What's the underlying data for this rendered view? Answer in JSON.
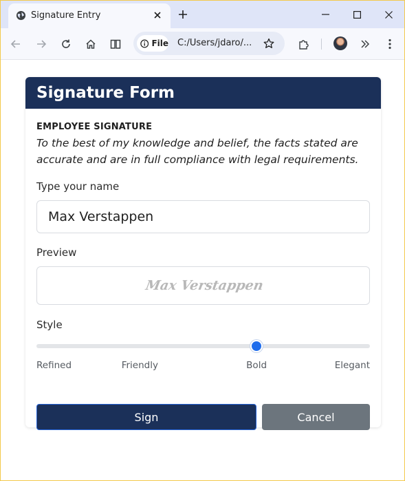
{
  "browser": {
    "tab_title": "Signature Entry",
    "file_chip": "File",
    "url": "C:/Users/jdaro/..."
  },
  "form": {
    "title": "Signature Form",
    "section_heading": "EMPLOYEE SIGNATURE",
    "legal_text": "To the best of my knowledge and belief, the facts stated are accurate and are in full compliance with legal requirements.",
    "name_label": "Type your name",
    "name_value": "Max Verstappen",
    "preview_label": "Preview",
    "preview_signature": "Max Verstappen",
    "style_label": "Style",
    "style_options": [
      "Refined",
      "Friendly",
      "Bold",
      "Elegant"
    ],
    "style_selected": "Bold",
    "style_slider_fraction": 0.66,
    "sign_button": "Sign",
    "cancel_button": "Cancel"
  },
  "colors": {
    "header_bg": "#1b3059",
    "accent": "#1f6dec",
    "cancel_bg": "#6c757d"
  }
}
